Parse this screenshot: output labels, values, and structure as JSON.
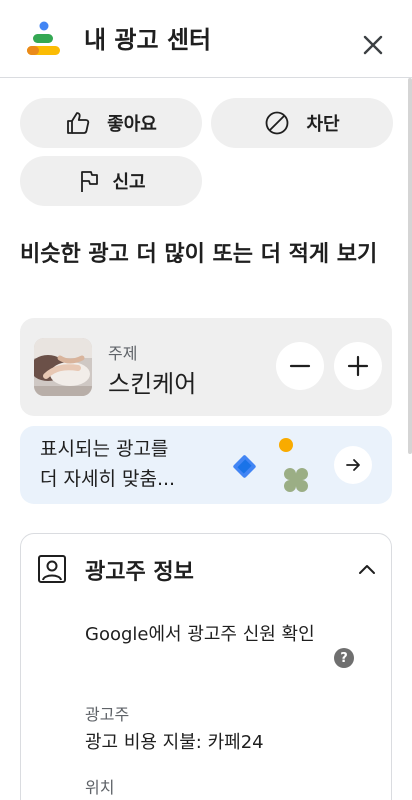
{
  "header": {
    "title": "내 광고 센터",
    "logo_icon": "my-ad-center-logo",
    "close_icon": "close-icon"
  },
  "actions": {
    "like_label": "좋아요",
    "block_label": "차단",
    "report_label": "신고"
  },
  "section": {
    "heading": "비슷한 광고 더 많이 또는 더 적게 보기"
  },
  "topic": {
    "caption": "주제",
    "name": "스킨케어"
  },
  "promo": {
    "line1": "표시되는 광고를",
    "line2": "더 자세히 맞춤..."
  },
  "advertiser": {
    "title": "광고주 정보",
    "verify_text": "Google에서 광고주 신원 확인",
    "help_symbol": "?",
    "advertiser_label": "광고주",
    "advertiser_value": "광고 비용 지불: 카페24",
    "location_label": "위치"
  },
  "colors": {
    "pill_bg": "#efefef",
    "promo_bg": "#eaf2fb",
    "text": "#1f1f1f",
    "secondary_text": "#5f6368",
    "logo_blue": "#4285f4",
    "logo_green": "#34a853",
    "logo_yellow": "#fbbc04"
  }
}
